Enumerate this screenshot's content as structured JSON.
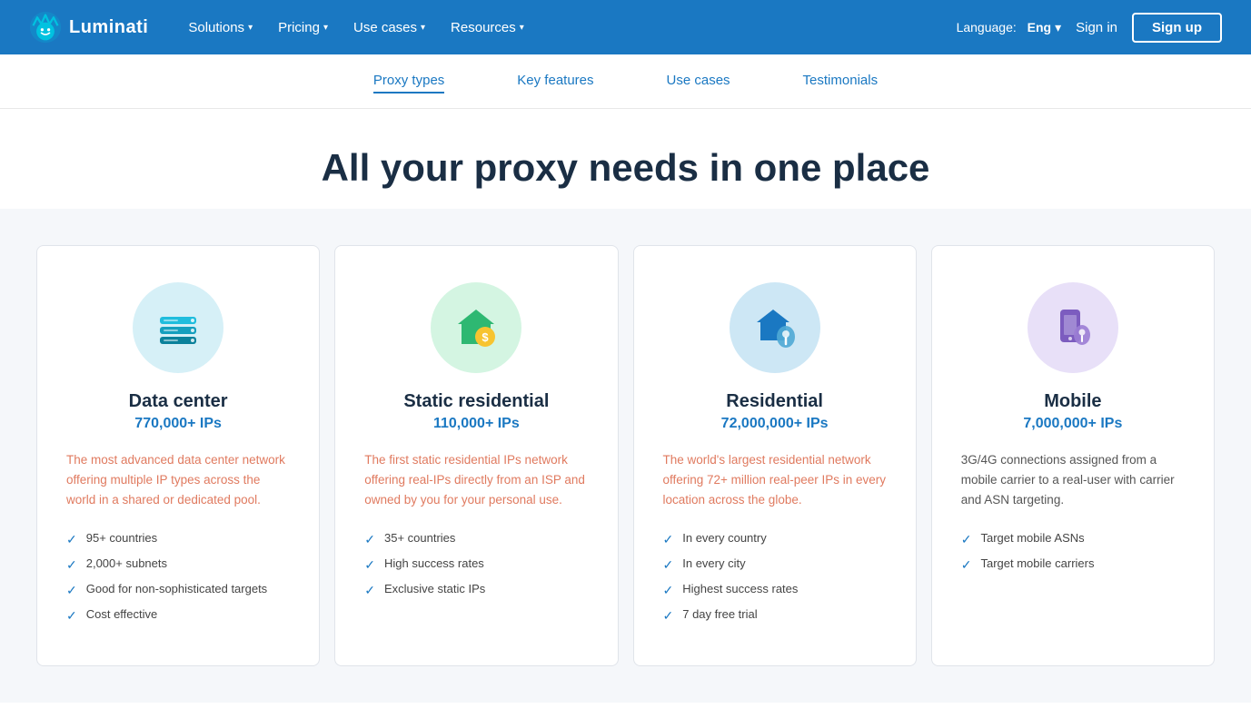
{
  "brand": {
    "name": "Luminati"
  },
  "nav": {
    "links": [
      {
        "label": "Solutions",
        "hasDropdown": true
      },
      {
        "label": "Pricing",
        "hasDropdown": true
      },
      {
        "label": "Use cases",
        "hasDropdown": true
      },
      {
        "label": "Resources",
        "hasDropdown": true
      }
    ],
    "language_label": "Language:",
    "language_value": "Eng",
    "signin_label": "Sign in",
    "signup_label": "Sign up"
  },
  "sub_nav": {
    "items": [
      {
        "label": "Proxy types",
        "active": true
      },
      {
        "label": "Key features",
        "active": false
      },
      {
        "label": "Use cases",
        "active": false
      },
      {
        "label": "Testimonials",
        "active": false
      }
    ]
  },
  "hero": {
    "title": "All your proxy needs in one place"
  },
  "cards": [
    {
      "id": "datacenter",
      "icon_type": "datacenter",
      "title": "Data center",
      "subtitle": "770,000+ IPs",
      "desc": "The most advanced data center network offering multiple IP types across the world in a shared or dedicated pool.",
      "desc_colored": true,
      "features": [
        "95+ countries",
        "2,000+ subnets",
        "Good for non-sophisticated targets",
        "Cost effective"
      ]
    },
    {
      "id": "static-residential",
      "icon_type": "static-res",
      "title": "Static residential",
      "subtitle": "110,000+ IPs",
      "desc": "The first static residential IPs network offering real-IPs directly from an ISP and owned by you for your personal use.",
      "desc_colored": true,
      "features": [
        "35+ countries",
        "High success rates",
        "Exclusive static IPs"
      ]
    },
    {
      "id": "residential",
      "icon_type": "residential",
      "title": "Residential",
      "subtitle": "72,000,000+ IPs",
      "desc": "The world's largest residential network offering 72+ million real-peer IPs in every location across the globe.",
      "desc_colored": true,
      "features": [
        "In every country",
        "In every city",
        "Highest success rates",
        "7 day free trial"
      ]
    },
    {
      "id": "mobile",
      "icon_type": "mobile",
      "title": "Mobile",
      "subtitle": "7,000,000+ IPs",
      "desc": "3G/4G connections assigned from a mobile carrier to a real-user with carrier and ASN targeting.",
      "desc_colored": false,
      "features": [
        "Target mobile ASNs",
        "Target mobile carriers"
      ]
    }
  ]
}
